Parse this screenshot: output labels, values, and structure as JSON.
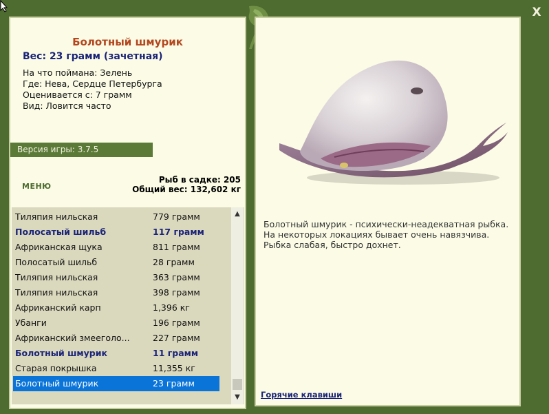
{
  "fish": {
    "title": "Болотный шмурик",
    "weight": "Вес: 23 грамм (зачетная)",
    "bait": "На что поймана: Зелень",
    "location": "Где: Нева, Сердце Петербурга",
    "rated": "Оценивается с: 7 грамм",
    "kind": "Вид: Ловится часто",
    "description": [
      "Болотный шмурик - психически-неадекватная рыбка.",
      "На некоторых локациях бывает очень навязчива.",
      "Рыбка слабая, быстро дохнет."
    ]
  },
  "version": "Версия игры: 3.7.5",
  "menu_label": "МЕНЮ",
  "stats": {
    "count": "Рыб в садке: 205",
    "total": "Общий вес: 132,602 кг"
  },
  "catch_list": [
    {
      "name": "Тиляпия нильская",
      "weight": "779 грамм",
      "bold": false
    },
    {
      "name": "Полосатый шильб",
      "weight": "117 грамм",
      "bold": true
    },
    {
      "name": "Африканская щука",
      "weight": "811 грамм",
      "bold": false
    },
    {
      "name": "Полосатый шильб",
      "weight": "28 грамм",
      "bold": false
    },
    {
      "name": "Тиляпия нильская",
      "weight": "363 грамм",
      "bold": false
    },
    {
      "name": "Тиляпия нильская",
      "weight": "398 грамм",
      "bold": false
    },
    {
      "name": "Африканский карп",
      "weight": "1,396 кг",
      "bold": false
    },
    {
      "name": "Убанги",
      "weight": "196 грамм",
      "bold": false
    },
    {
      "name": "Африканский змееголо...",
      "weight": "227 грамм",
      "bold": false
    },
    {
      "name": "Болотный шмурик",
      "weight": "11 грамм",
      "bold": true
    },
    {
      "name": "Старая покрышка",
      "weight": "11,355 кг",
      "bold": false
    },
    {
      "name": "Болотный шмурик",
      "weight": "23 грамм",
      "bold": false,
      "selected": true
    }
  ],
  "hotkeys_label": "Горячие клавиши",
  "close_label": "X",
  "colors": {
    "frame": "#4e6b30",
    "panel": "#fbfbe6",
    "title": "#b4451d",
    "accent_blue": "#1a2378",
    "selection": "#0a74d8"
  }
}
